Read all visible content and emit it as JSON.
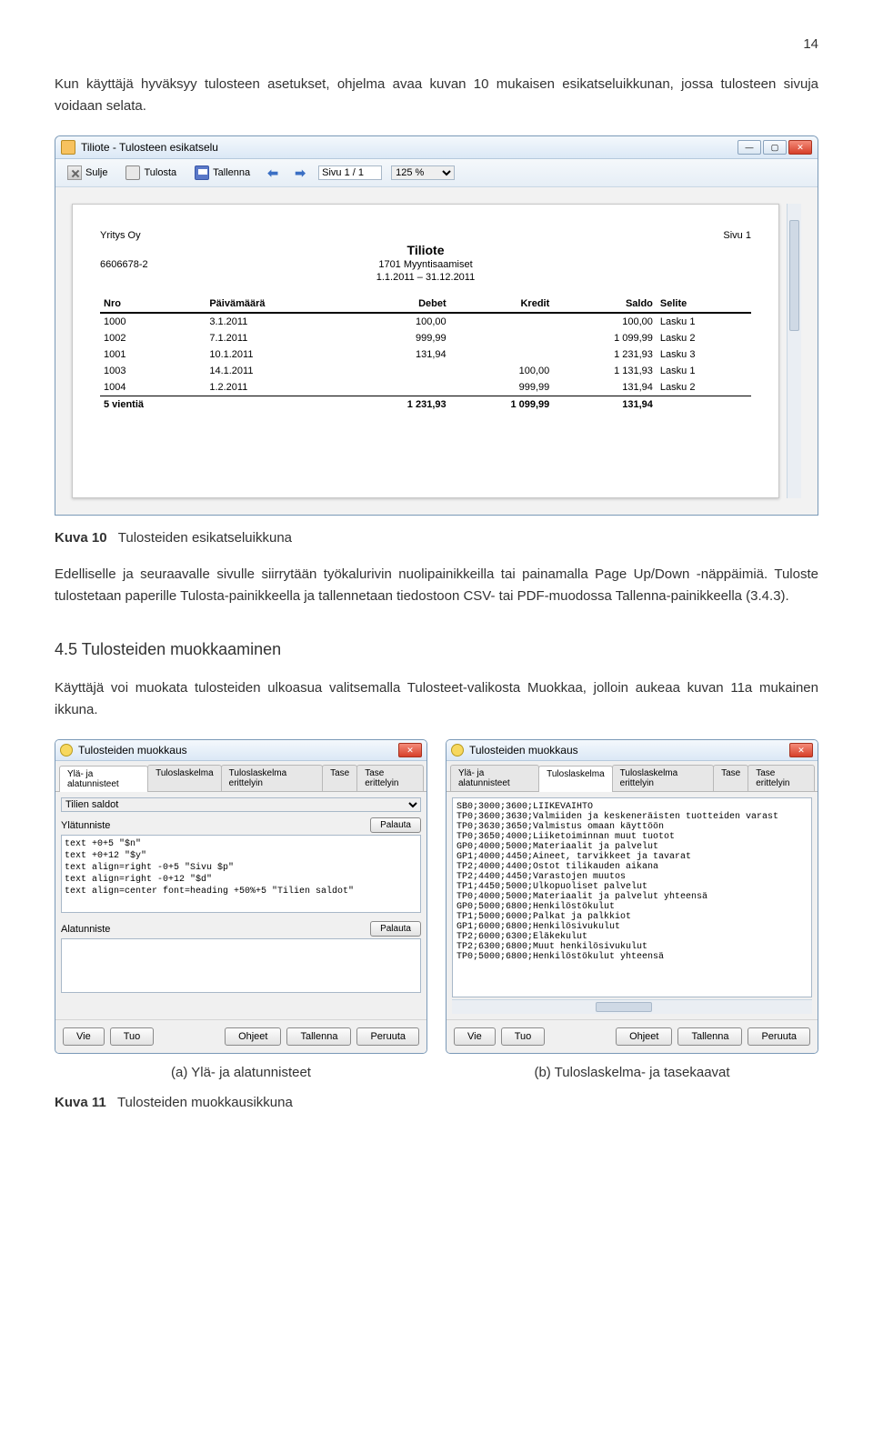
{
  "page_number_top": "14",
  "para1": "Kun käyttäjä hyväksyy tulosteen asetukset, ohjelma avaa kuvan 10 mukaisen esikatseluikkunan, jossa tulosteen sivuja voidaan selata.",
  "preview": {
    "window_title": "Tiliote - Tulosteen esikatselu",
    "toolbar": {
      "close": "Sulje",
      "print": "Tulosta",
      "save": "Tallenna",
      "page_value": "Sivu 1 / 1",
      "zoom_value": "125 %"
    },
    "report": {
      "company": "Yritys Oy",
      "title": "Tiliote",
      "page_lbl": "Sivu 1",
      "ytunnus": "6606678-2",
      "account": "1701 Myyntisaamiset",
      "period": "1.1.2011 – 31.12.2011",
      "headers": [
        "Nro",
        "Päivämäärä",
        "Debet",
        "Kredit",
        "Saldo",
        "Selite"
      ],
      "rows": [
        [
          "1000",
          "3.1.2011",
          "100,00",
          "",
          "100,00",
          "Lasku 1"
        ],
        [
          "1002",
          "7.1.2011",
          "999,99",
          "",
          "1 099,99",
          "Lasku 2"
        ],
        [
          "1001",
          "10.1.2011",
          "131,94",
          "",
          "1 231,93",
          "Lasku 3"
        ],
        [
          "1003",
          "14.1.2011",
          "",
          "100,00",
          "1 131,93",
          "Lasku 1"
        ],
        [
          "1004",
          "1.2.2011",
          "",
          "999,99",
          "131,94",
          "Lasku 2"
        ]
      ],
      "footer": [
        "5 vientiä",
        "",
        "1 231,93",
        "1 099,99",
        "131,94",
        ""
      ]
    }
  },
  "caption10_label": "Kuva 10",
  "caption10_text": "Tulosteiden esikatseluikkuna",
  "para2": "Edelliselle ja seuraavalle sivulle siirrytään työkalurivin nuolipainikkeilla tai painamalla Page Up/Down -näppäimiä. Tuloste tulostetaan paperille Tulosta-painikkeella ja tallennetaan tiedostoon CSV- tai PDF-muodossa Tallenna-painikkeella (3.4.3).",
  "section_heading": "4.5  Tulosteiden muokkaaminen",
  "para3": "Käyttäjä voi muokata tulosteiden ulkoasua valitsemalla Tulosteet-valikosta Muokkaa, jolloin aukeaa kuvan 11a mukainen ikkuna.",
  "dialog_a": {
    "title": "Tulosteiden muokkaus",
    "tabs": [
      "Ylä- ja alatunnisteet",
      "Tuloslaskelma",
      "Tuloslaskelma erittelyin",
      "Tase",
      "Tase erittelyin"
    ],
    "active_tab": 0,
    "select_value": "Tilien saldot",
    "label_top": "Ylätunniste",
    "restore": "Palauta",
    "top_text": "text +0+5 \"$n\"\ntext +0+12 \"$y\"\ntext align=right -0+5 \"Sivu $p\"\ntext align=right -0+12 \"$d\"\ntext align=center font=heading +50%+5 \"Tilien saldot\"",
    "label_bottom": "Alatunniste",
    "bottom_text": "",
    "buttons": [
      "Vie",
      "Tuo",
      "Ohjeet",
      "Tallenna",
      "Peruuta"
    ]
  },
  "dialog_b": {
    "title": "Tulosteiden muokkaus",
    "tabs": [
      "Ylä- ja alatunnisteet",
      "Tuloslaskelma",
      "Tuloslaskelma erittelyin",
      "Tase",
      "Tase erittelyin"
    ],
    "active_tab": 1,
    "content": "SB0;3000;3600;LIIKEVAIHTO\nTP0;3600;3630;Valmiiden ja keskeneräisten tuotteiden varast\nTP0;3630;3650;Valmistus omaan käyttöön\nTP0;3650;4000;Liiketoiminnan muut tuotot\nGP0;4000;5000;Materiaalit ja palvelut\nGP1;4000;4450;Aineet, tarvikkeet ja tavarat\nTP2;4000;4400;Ostot tilikauden aikana\nTP2;4400;4450;Varastojen muutos\nTP1;4450;5000;Ulkopuoliset palvelut\nTP0;4000;5000;Materiaalit ja palvelut yhteensä\nGP0;5000;6800;Henkilöstökulut\nTP1;5000;6000;Palkat ja palkkiot\nGP1;6000;6800;Henkilösivukulut\nTP2;6000;6300;Eläkekulut\nTP2;6300;6800;Muut henkilösivukulut\nTP0;5000;6800;Henkilöstökulut yhteensä",
    "buttons": [
      "Vie",
      "Tuo",
      "Ohjeet",
      "Tallenna",
      "Peruuta"
    ]
  },
  "sub_a": "(a) Ylä- ja alatunnisteet",
  "sub_b": "(b) Tuloslaskelma- ja tasekaavat",
  "caption11_label": "Kuva 11",
  "caption11_text": "Tulosteiden muokkausikkuna"
}
